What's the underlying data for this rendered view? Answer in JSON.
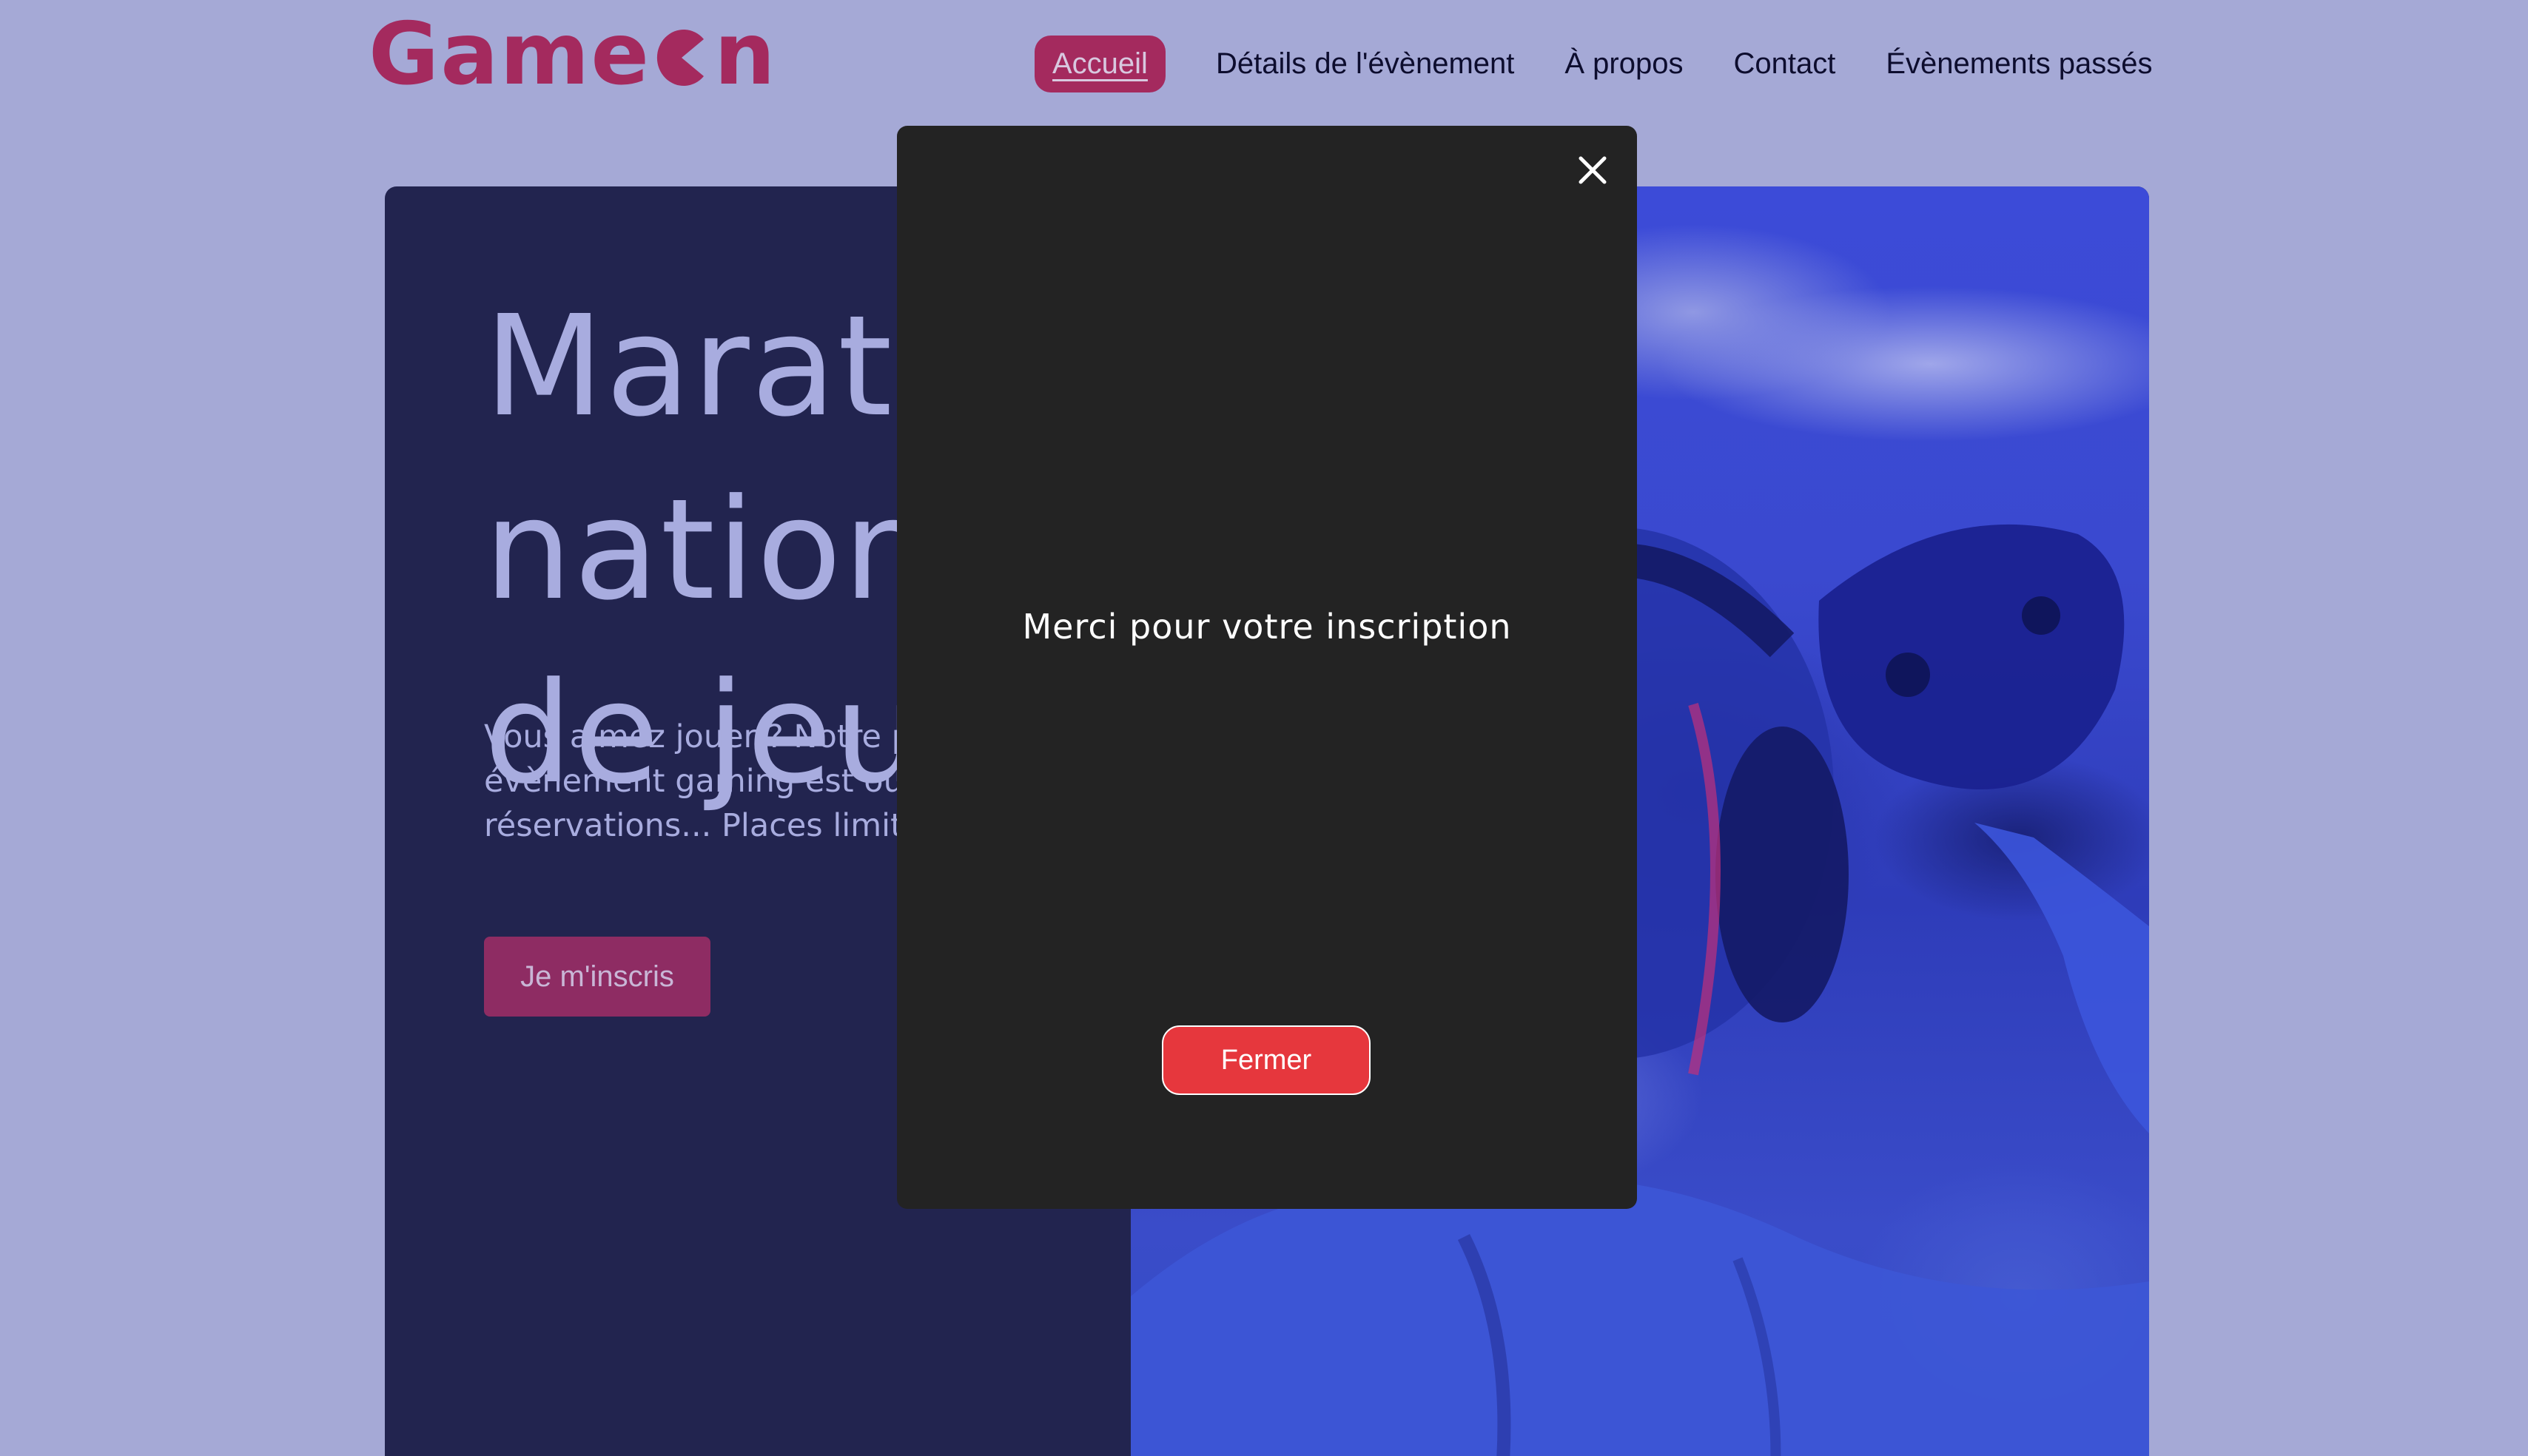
{
  "header": {
    "logo_text_start": "Game",
    "logo_text_end": "n",
    "nav": [
      {
        "label": "Accueil",
        "active": true
      },
      {
        "label": "Détails de l'évènement",
        "active": false
      },
      {
        "label": "À propos",
        "active": false
      },
      {
        "label": "Contact",
        "active": false
      },
      {
        "label": "Évènements passés",
        "active": false
      }
    ]
  },
  "hero": {
    "title_line1": "Marathon national",
    "title_line2": "de jeux vidéos",
    "description": "Vous aimez jouer ? Notre prochain évènement gaming est ouvert aux réservations... Places limitées !",
    "cta_label": "Je m'inscris"
  },
  "modal": {
    "message": "Merci pour votre inscription",
    "close_button_label": "Fermer",
    "close_icon": "close-icon"
  },
  "colors": {
    "page_background": "#a5a9d6",
    "brand": "#a42a5e",
    "hero_panel": "#22244f",
    "modal_background": "#232323",
    "modal_button": "#e6373d"
  }
}
